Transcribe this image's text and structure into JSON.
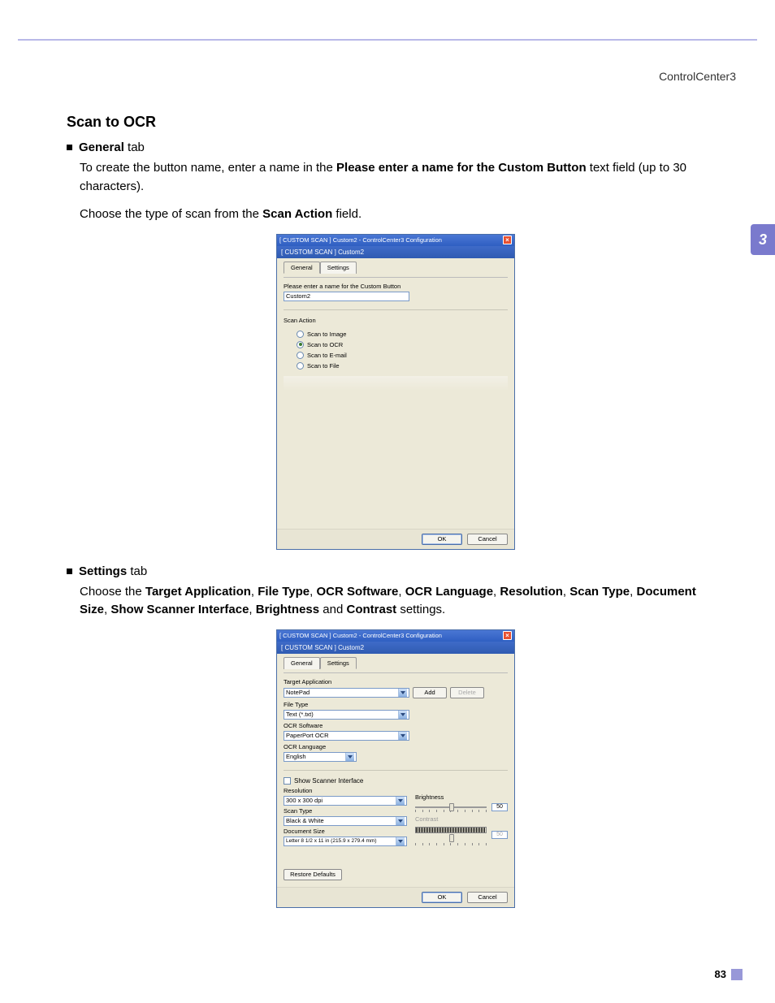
{
  "header": "ControlCenter3",
  "side_tab": "3",
  "page_num": "83",
  "section_title": "Scan to OCR",
  "general_tab_label": "General",
  "tab_word": " tab",
  "para1_a": "To create the button name, enter a name in the ",
  "para1_bold": "Please enter a name for the Custom Button",
  "para1_b": " text field (up to 30 characters).",
  "para2_a": "Choose the type of scan from the ",
  "para2_bold": "Scan Action",
  "para2_b": " field.",
  "settings_tab_label": "Settings",
  "para3_a": "Choose the ",
  "para3_list": "Target Application, File Type, OCR Software, OCR Language, Resolution, Scan Type, Document Size, Show Scanner Interface, Brightness and Contrast",
  "para3_b": " settings.",
  "dialog1": {
    "title": "[ CUSTOM SCAN ]  Custom2 - ControlCenter3 Configuration",
    "subbar": "[ CUSTOM SCAN ]  Custom2",
    "tabs": {
      "general": "General",
      "settings": "Settings"
    },
    "name_label": "Please enter a name for the Custom Button",
    "name_value": "Custom2",
    "scan_action_label": "Scan Action",
    "radios": {
      "image": "Scan to Image",
      "ocr": "Scan to OCR",
      "email": "Scan to E-mail",
      "file": "Scan to File"
    },
    "ok": "OK",
    "cancel": "Cancel"
  },
  "dialog2": {
    "title": "[ CUSTOM SCAN ]  Custom2 - ControlCenter3 Configuration",
    "subbar": "[ CUSTOM SCAN ]  Custom2",
    "tabs": {
      "general": "General",
      "settings": "Settings"
    },
    "target_app_label": "Target Application",
    "target_app_value": "NotePad",
    "add": "Add",
    "delete": "Delete",
    "file_type_label": "File Type",
    "file_type_value": "Text (*.txt)",
    "ocr_sw_label": "OCR Software",
    "ocr_sw_value": "PaperPort OCR",
    "ocr_lang_label": "OCR Language",
    "ocr_lang_value": "English",
    "show_scanner": "Show Scanner Interface",
    "resolution_label": "Resolution",
    "resolution_value": "300 x 300 dpi",
    "scan_type_label": "Scan Type",
    "scan_type_value": "Black & White",
    "doc_size_label": "Document Size",
    "doc_size_value": "Letter 8 1/2 x 11 in (215.9 x 279.4 mm)",
    "brightness_label": "Brightness",
    "brightness_value": "50",
    "contrast_label": "Contrast",
    "contrast_value": "50",
    "restore": "Restore Defaults",
    "ok": "OK",
    "cancel": "Cancel"
  }
}
